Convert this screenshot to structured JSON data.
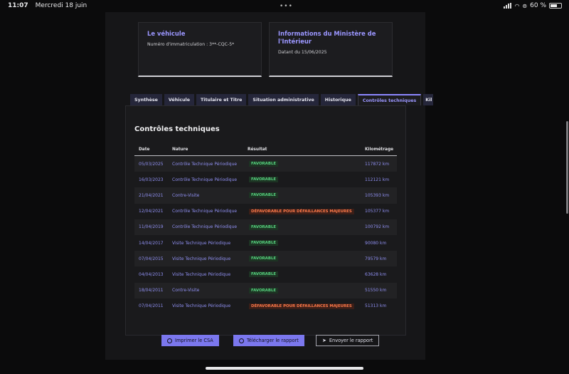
{
  "status_bar": {
    "time": "11:07",
    "date": "Mercredi 18 juin",
    "dots": "•••",
    "battery": "60 %"
  },
  "cards": {
    "vehicle": {
      "title": "Le véhicule",
      "text": "Numéro d'immatriculation : 3**-CQC-5*"
    },
    "ministry": {
      "title": "Informations du Ministère de l'Intérieur",
      "text": "Datant du 15/06/2025"
    }
  },
  "tabs": [
    {
      "label": "Synthèse"
    },
    {
      "label": "Véhicule"
    },
    {
      "label": "Titulaire et Titre"
    },
    {
      "label": "Situation administrative"
    },
    {
      "label": "Historique"
    },
    {
      "label": "Contrôles techniques"
    },
    {
      "label": "Kil"
    }
  ],
  "active_tab": "Contrôles techniques",
  "section": {
    "title": "Contrôles techniques",
    "columns": {
      "date": "Date",
      "nature": "Nature",
      "result": "Résultat",
      "km": "Kilométrage"
    },
    "rows": [
      {
        "date": "05/03/2025",
        "nature": "Contrôle Technique Périodique",
        "result": "FAVORABLE",
        "status": "fav",
        "km": "117872 km"
      },
      {
        "date": "16/03/2023",
        "nature": "Contrôle Technique Périodique",
        "result": "FAVORABLE",
        "status": "fav",
        "km": "112121 km"
      },
      {
        "date": "21/04/2021",
        "nature": "Contre-Visite",
        "result": "FAVORABLE",
        "status": "fav",
        "km": "105393 km"
      },
      {
        "date": "12/04/2021",
        "nature": "Contrôle Technique Périodique",
        "result": "DÉFAVORABLE POUR DÉFAILLANCES MAJEURES",
        "status": "def",
        "km": "105377 km"
      },
      {
        "date": "11/04/2019",
        "nature": "Contrôle Technique Périodique",
        "result": "FAVORABLE",
        "status": "fav",
        "km": "100792 km"
      },
      {
        "date": "14/04/2017",
        "nature": "Visite Technique Périodique",
        "result": "FAVORABLE",
        "status": "fav",
        "km": "90080 km"
      },
      {
        "date": "07/04/2015",
        "nature": "Visite Technique Périodique",
        "result": "FAVORABLE",
        "status": "fav",
        "km": "79579 km"
      },
      {
        "date": "04/04/2013",
        "nature": "Visite Technique Périodique",
        "result": "FAVORABLE",
        "status": "fav",
        "km": "63628 km"
      },
      {
        "date": "18/04/2011",
        "nature": "Contre-Visite",
        "result": "FAVORABLE",
        "status": "fav",
        "km": "51550 km"
      },
      {
        "date": "07/04/2011",
        "nature": "Visite Technique Périodique",
        "result": "DÉFAVORABLE POUR DÉFAILLANCES MAJEURES",
        "status": "def",
        "km": "51313 km"
      }
    ]
  },
  "buttons": {
    "print": "Imprimer le CSA",
    "download": "Télécharger le rapport",
    "send": "Envoyer le rapport"
  }
}
